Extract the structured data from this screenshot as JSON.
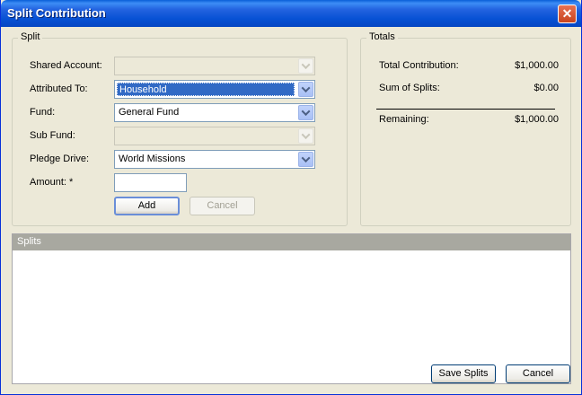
{
  "window": {
    "title": "Split Contribution",
    "close_glyph": "✕"
  },
  "split": {
    "legend": "Split",
    "shared_account_label": "Shared Account:",
    "shared_account_value": "",
    "attributed_to_label": "Attributed To:",
    "attributed_to_value": "Household",
    "fund_label": "Fund:",
    "fund_value": "General Fund",
    "sub_fund_label": "Sub Fund:",
    "sub_fund_value": "",
    "pledge_drive_label": "Pledge Drive:",
    "pledge_drive_value": "World Missions",
    "amount_label": "Amount: *",
    "amount_value": "",
    "add_label": "Add",
    "cancel_label": "Cancel"
  },
  "totals": {
    "legend": "Totals",
    "total_contribution_label": "Total Contribution:",
    "total_contribution_value": "$1,000.00",
    "sum_of_splits_label": "Sum of Splits:",
    "sum_of_splits_value": "$0.00",
    "remaining_label": "Remaining:",
    "remaining_value": "$1,000.00"
  },
  "splits": {
    "header": "Splits"
  },
  "footer": {
    "save_label": "Save Splits",
    "cancel_label": "Cancel"
  },
  "colors": {
    "title_bar": "#0751d4",
    "selection": "#316ac5",
    "splits_header": "#a8a8a0"
  }
}
